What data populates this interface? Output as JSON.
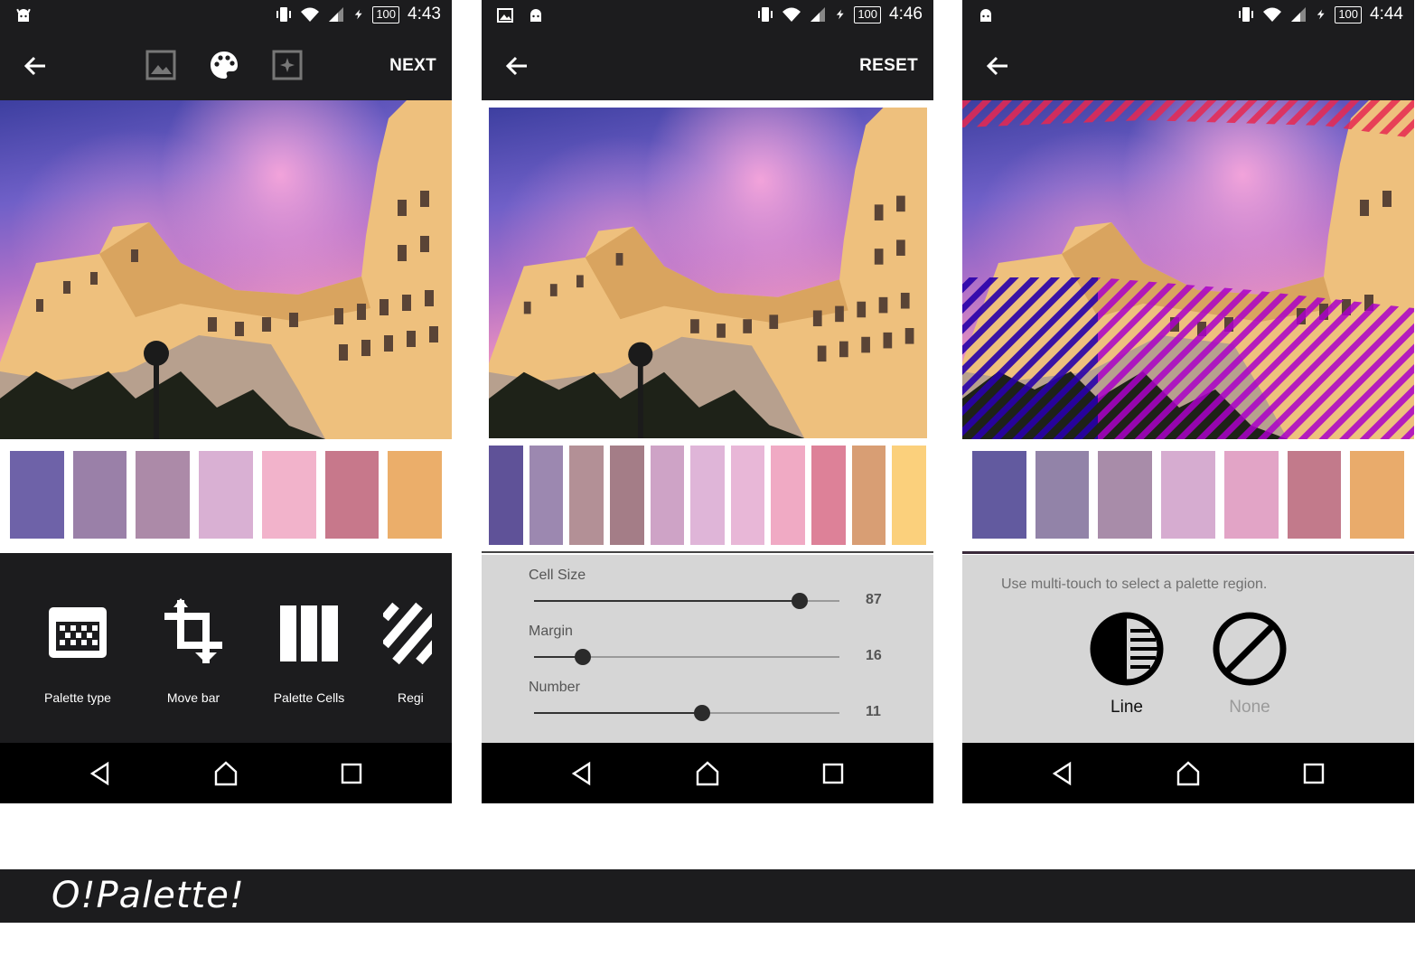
{
  "screens": [
    {
      "status_time": "4:43",
      "battery": "100",
      "appbar_action": "NEXT",
      "swatches": [
        "#6e62a8",
        "#9a80a8",
        "#ac8aa8",
        "#d9b0d3",
        "#f2b3cb",
        "#c7788b",
        "#ebae6a"
      ],
      "tools": [
        {
          "label": "Palette type",
          "icon": "palette-type-icon"
        },
        {
          "label": "Move bar",
          "icon": "crop-icon"
        },
        {
          "label": "Palette Cells",
          "icon": "palette-cells-icon"
        },
        {
          "label": "Regi",
          "icon": "region-icon"
        }
      ]
    },
    {
      "status_time": "4:46",
      "battery": "100",
      "appbar_action": "RESET",
      "swatches": [
        "#5f5298",
        "#9c88b0",
        "#b39096",
        "#a47d87",
        "#cea3c6",
        "#dfb5d8",
        "#e8b7d7",
        "#f0aac4",
        "#dd8198",
        "#d89e74",
        "#fbd07c"
      ],
      "sliders": [
        {
          "label": "Cell Size",
          "value": "87",
          "fraction": 0.87
        },
        {
          "label": "Margin",
          "value": "16",
          "fraction": 0.16
        },
        {
          "label": "Number",
          "value": "11",
          "fraction": 0.55
        }
      ]
    },
    {
      "status_time": "4:44",
      "battery": "100",
      "swatches": [
        "#625a9f",
        "#9283a8",
        "#a88ca9",
        "#d6acd0",
        "#e2a4c6",
        "#c27a8b",
        "#e9ab6b"
      ],
      "hint": "Use multi-touch to select a palette region.",
      "options": [
        {
          "label": "Line",
          "icon": "line-region-icon",
          "active": true
        },
        {
          "label": "None",
          "icon": "none-icon",
          "active": false
        }
      ]
    }
  ],
  "banner": {
    "title": "O!Palette!"
  }
}
